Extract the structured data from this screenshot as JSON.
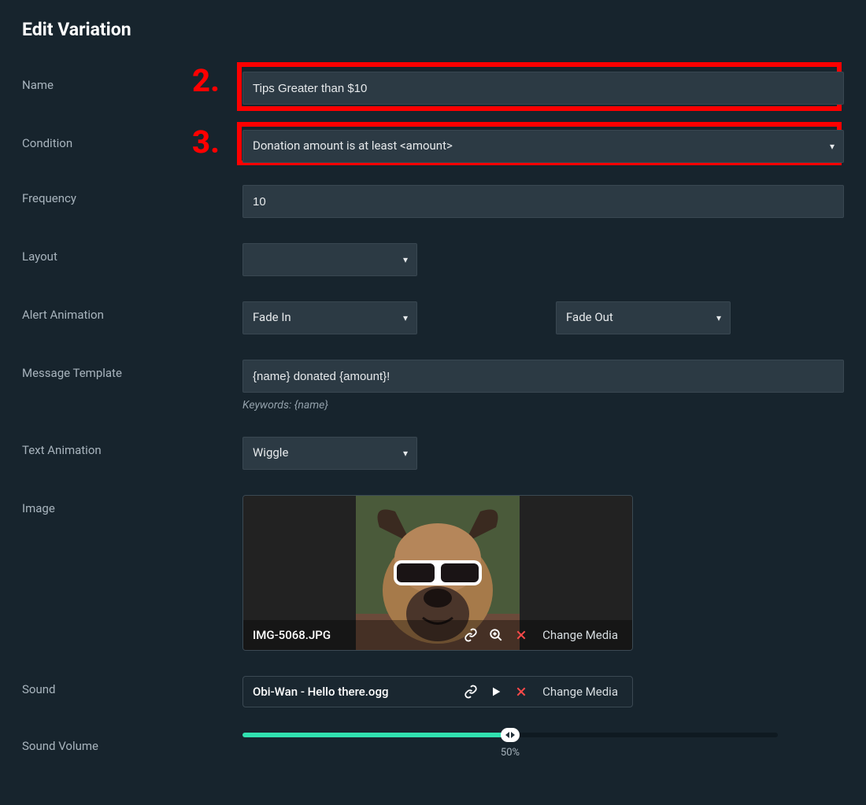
{
  "title": "Edit Variation",
  "annotations": {
    "step2": "2.",
    "step3": "3."
  },
  "labels": {
    "name": "Name",
    "condition": "Condition",
    "frequency": "Frequency",
    "layout": "Layout",
    "alertAnimation": "Alert Animation",
    "messageTemplate": "Message Template",
    "textAnimation": "Text Animation",
    "image": "Image",
    "sound": "Sound",
    "soundVolume": "Sound Volume"
  },
  "fields": {
    "name": "Tips Greater than $10",
    "condition": "Donation amount is at least <amount>",
    "frequency": "10",
    "layout": "",
    "alertIn": "Fade In",
    "alertOut": "Fade Out",
    "messageTemplate": "{name} donated {amount}!",
    "keywordsHint": "Keywords: {name}",
    "textAnimation": "Wiggle",
    "imageFile": "IMG-5068.JPG",
    "soundFile": "Obi-Wan - Hello there.ogg",
    "changeMedia": "Change Media",
    "volumePercent": 50,
    "volumeLabel": "50%"
  }
}
